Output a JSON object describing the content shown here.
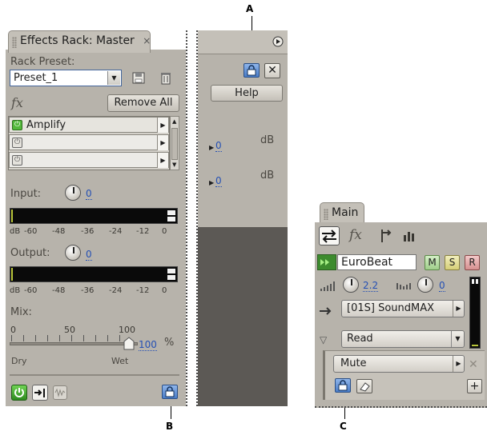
{
  "callouts": {
    "a": "A",
    "b": "B",
    "c": "C"
  },
  "effects_rack": {
    "tab_title": "Effects Rack: Master",
    "tab_close": "×",
    "rack_preset_label": "Rack Preset:",
    "preset_value": "Preset_1",
    "fx_label": "fx",
    "remove_all_label": "Remove All",
    "slots": [
      {
        "name": "Amplify",
        "power": "on"
      },
      {
        "name": "",
        "power": "off"
      },
      {
        "name": "",
        "power": "off"
      }
    ],
    "input_label": "Input:",
    "input_value": "0",
    "output_label": "Output:",
    "output_value": "0",
    "meter_scale": [
      "dB",
      "-60",
      "-48",
      "-36",
      "-24",
      "-12",
      "0"
    ],
    "mix_label": "Mix:",
    "mix_scale": [
      "0",
      "50",
      "100"
    ],
    "mix_value": "100",
    "mix_unit": "%",
    "dry_label": "Dry",
    "wet_label": "Wet"
  },
  "effect_panel": {
    "help_label": "Help",
    "close_glyph": "✕",
    "gain_1_value": "0",
    "gain_1_unit": "dB",
    "gain_2_value": "0",
    "gain_2_unit": "dB"
  },
  "mixer": {
    "tab_title": "Main",
    "fx_label": "fx",
    "track_name": "EuroBeat",
    "m_label": "M",
    "s_label": "S",
    "r_label": "R",
    "volume_value": "2.2",
    "pan_value": "0",
    "output_value": "[01S] SoundMAX",
    "automation_value": "Read",
    "parameter_value": "Mute",
    "plus_label": "+",
    "x_label": "✕"
  },
  "colors": {
    "panel": "#b7b3ab",
    "accent_blue": "#2550b4",
    "power_green": "#53b83b",
    "dark_area": "#5c5955"
  }
}
